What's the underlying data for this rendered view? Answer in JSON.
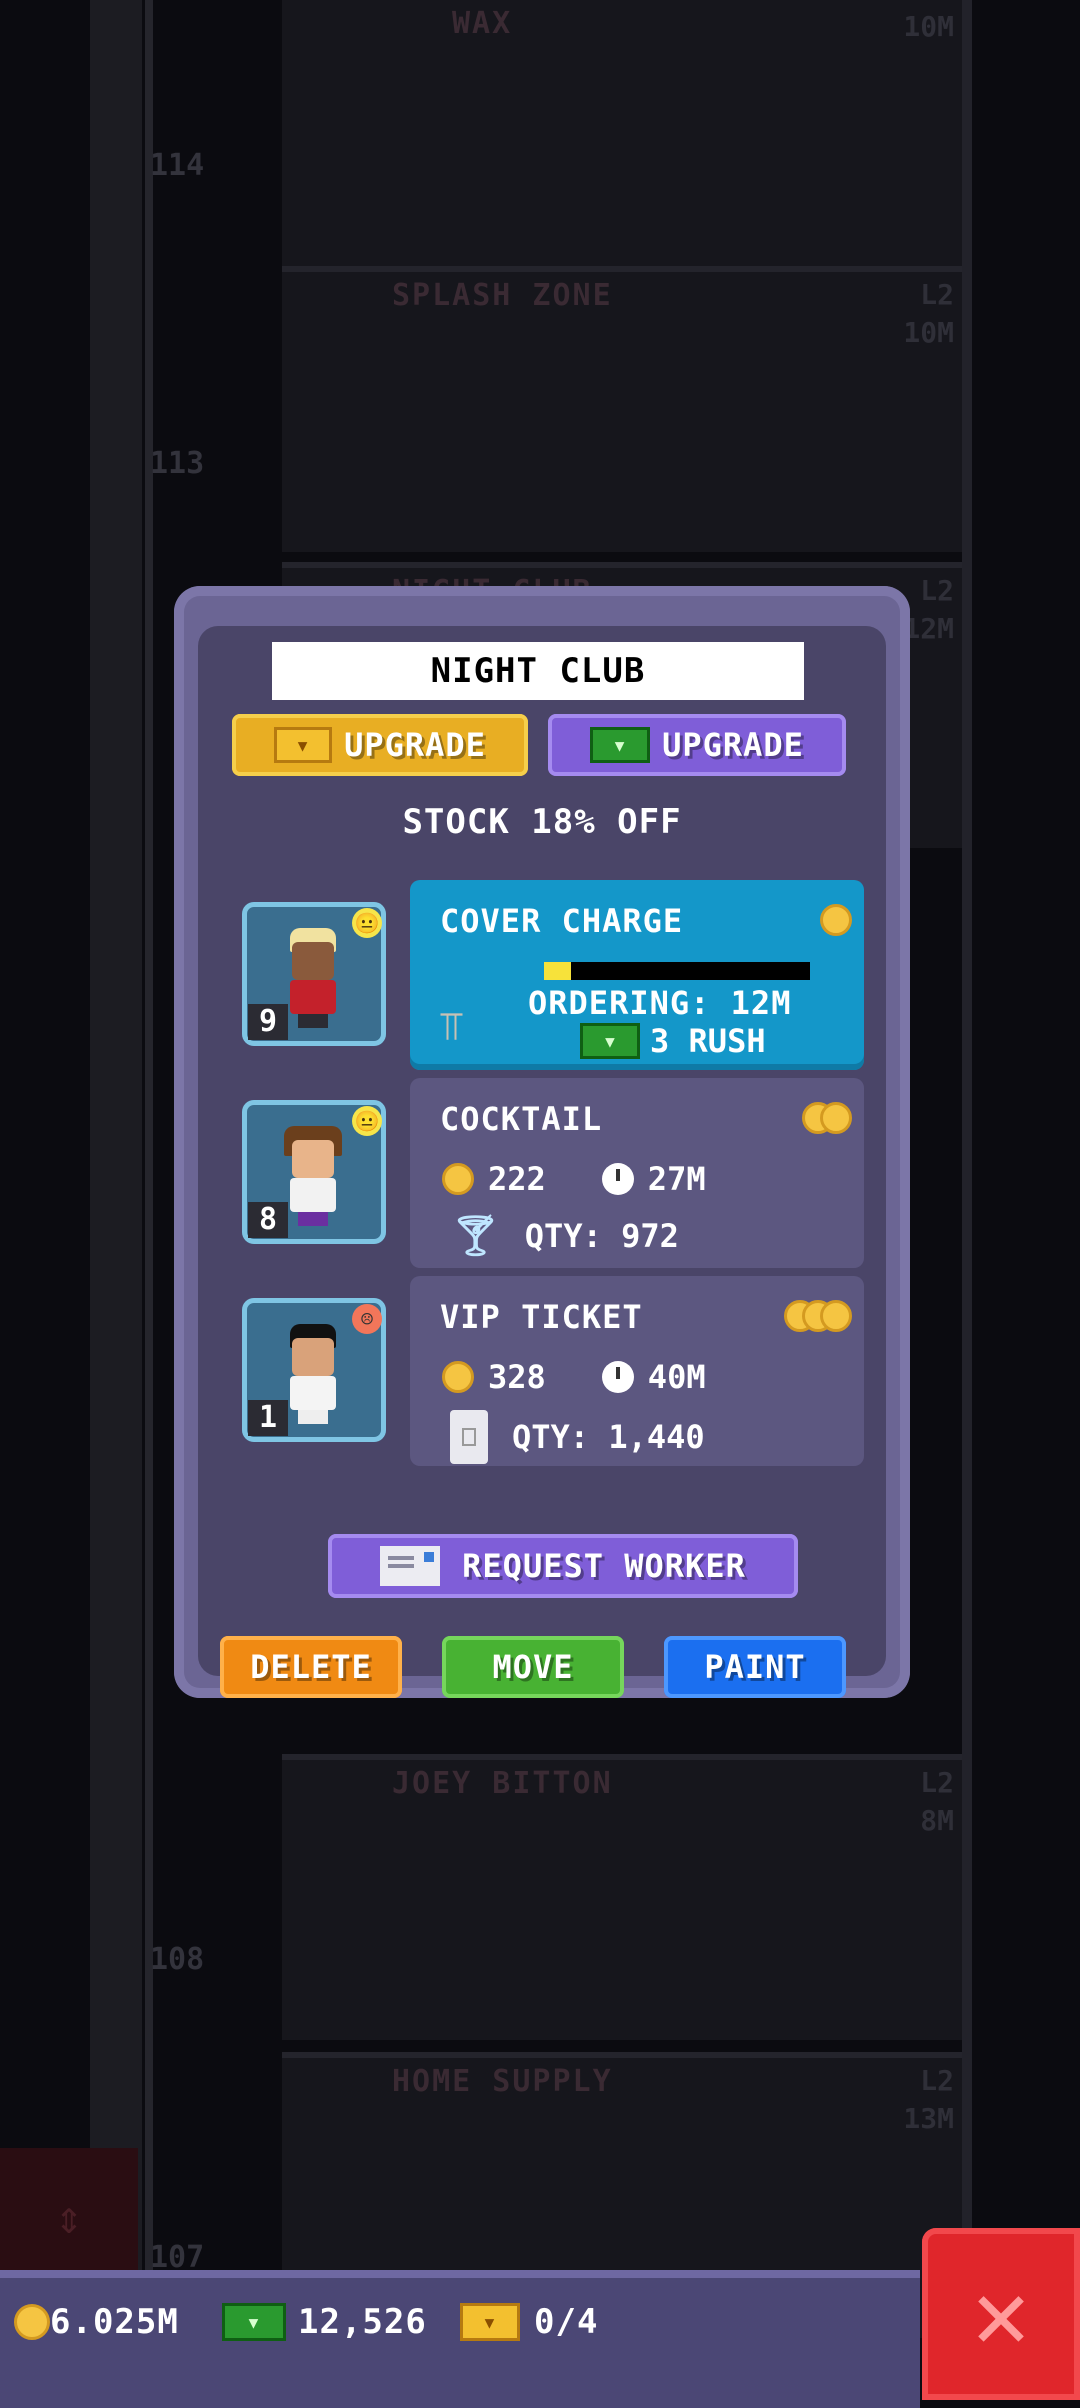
{
  "background": {
    "floors": [
      {
        "name": "WAX",
        "level": "",
        "price": "10M",
        "number": "114"
      },
      {
        "name": "SPLASH ZONE",
        "level": "L2",
        "price": "10M",
        "number": "113"
      },
      {
        "name": "NIGHT CLUB",
        "level": "L2",
        "price": "12M",
        "number": ""
      },
      {
        "name": "JOEY BITTON",
        "level": "L2",
        "price": "8M",
        "number": "108"
      },
      {
        "name": "HOME SUPPLY",
        "level": "L2",
        "price": "13M",
        "number": "107"
      }
    ]
  },
  "dialog": {
    "title": "NIGHT CLUB",
    "upgrade_gold_label": "UPGRADE",
    "upgrade_cash_label": "UPGRADE",
    "stock_discount": "STOCK 18% OFF",
    "workers": [
      {
        "level": "9",
        "mood": "neutral"
      },
      {
        "level": "8",
        "mood": "neutral"
      },
      {
        "level": "1",
        "mood": "unhappy"
      }
    ],
    "products": [
      {
        "name": "COVER CHARGE",
        "tier": 1,
        "progress": 0.1,
        "ordering": "ORDERING: 12M",
        "rush": "3 RUSH"
      },
      {
        "name": "COCKTAIL",
        "tier": 2,
        "price": "222",
        "time": "27M",
        "qty": "QTY: 972"
      },
      {
        "name": "VIP TICKET",
        "tier": 3,
        "price": "328",
        "time": "40M",
        "qty": "QTY: 1,440"
      }
    ],
    "request_worker_label": "REQUEST WORKER",
    "delete_label": "DELETE",
    "move_label": "MOVE",
    "paint_label": "PAINT"
  },
  "statusbar": {
    "coins": "6.025M",
    "bux": "12,526",
    "tickets": "0/4"
  },
  "colors": {
    "dialog_bg": "#4a4568",
    "gold": "#e8ae23",
    "purple": "#7f5ed8",
    "active_card": "#1497c9",
    "delete": "#f08a13",
    "move": "#48b233",
    "paint": "#1b6ff0",
    "close": "#e0262b"
  },
  "icons": [
    "golden-ticket-icon",
    "tower-bux-icon",
    "coin-icon",
    "clock-icon",
    "cocktail-glass-icon",
    "vip-ticket-icon",
    "velvet-rope-icon",
    "letter-icon",
    "close-x-icon",
    "elevator-arrows-icon"
  ]
}
